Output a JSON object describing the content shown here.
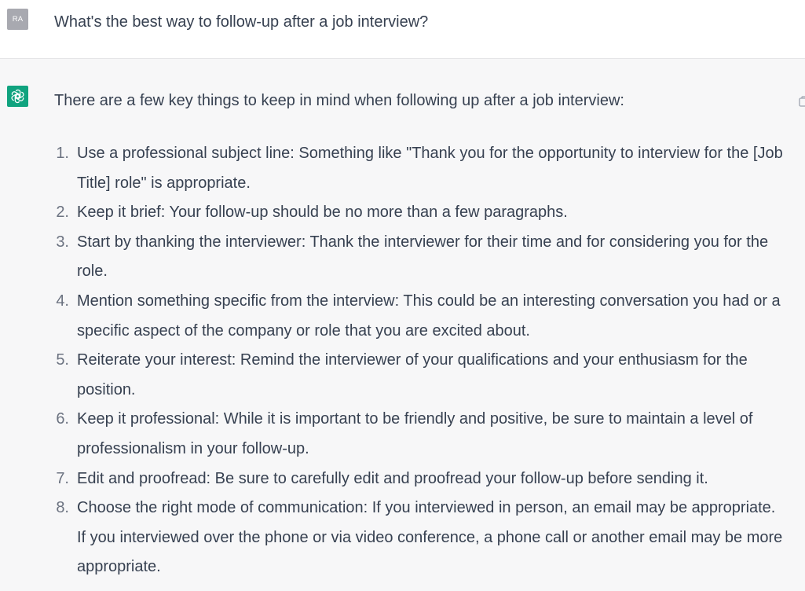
{
  "user": {
    "avatar_initials": "RA",
    "message": "What's the best way to follow-up after a job interview?"
  },
  "assistant": {
    "avatar_icon": "openai-logo-icon",
    "intro": "There are a few key things to keep in mind when following up after a job interview:",
    "items": [
      {
        "num": "1.",
        "text": "Use a professional subject line: Something like \"Thank you for the opportunity to interview for the [Job Title] role\" is appropriate."
      },
      {
        "num": "2.",
        "text": "Keep it brief: Your follow-up should be no more than a few paragraphs."
      },
      {
        "num": "3.",
        "text": "Start by thanking the interviewer: Thank the interviewer for their time and for considering you for the role."
      },
      {
        "num": "4.",
        "text": "Mention something specific from the interview: This could be an interesting conversation you had or a specific aspect of the company or role that you are excited about."
      },
      {
        "num": "5.",
        "text": "Reiterate your interest: Remind the interviewer of your qualifications and your enthusiasm for the position."
      },
      {
        "num": "6.",
        "text": "Keep it professional: While it is important to be friendly and positive, be sure to maintain a level of professionalism in your follow-up."
      },
      {
        "num": "7.",
        "text": "Edit and proofread: Be sure to carefully edit and proofread your follow-up before sending it."
      },
      {
        "num": "8.",
        "text": "Choose the right mode of communication: If you interviewed in person, an email may be appropriate. If you interviewed over the phone or via video conference, a phone call or another email may be more appropriate."
      }
    ]
  },
  "colors": {
    "assistant_bg": "#f7f7f8",
    "user_avatar": "#a8a9b0",
    "assistant_avatar": "#10a37f",
    "text": "#374151"
  }
}
